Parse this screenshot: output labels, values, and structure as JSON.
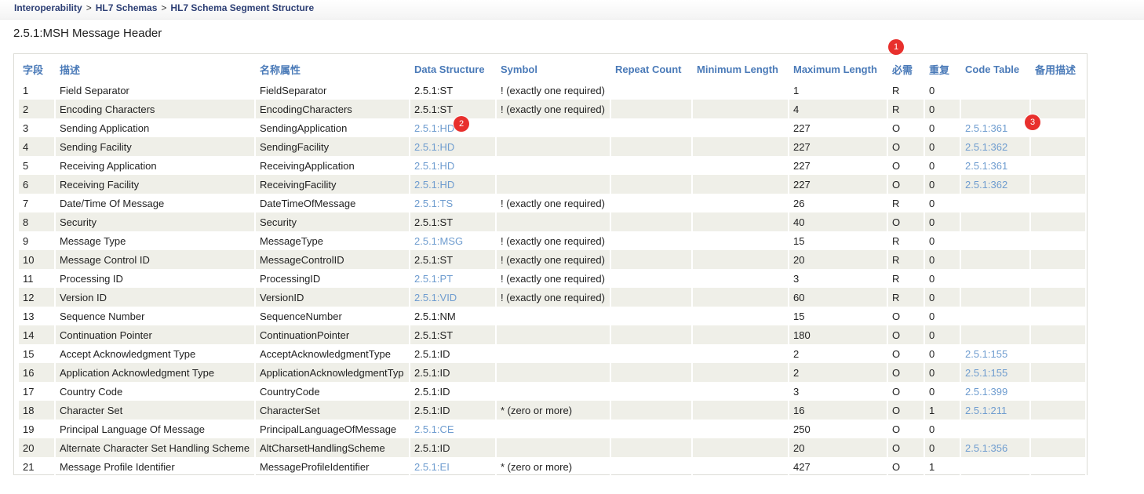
{
  "breadcrumb": {
    "items": [
      "Interoperability",
      "HL7 Schemas",
      "HL7 Schema Segment Structure"
    ],
    "separator": ">"
  },
  "page": {
    "title": "2.5.1:MSH Message Header"
  },
  "colors": {
    "header_text": "#4a7ab8",
    "link": "#6e9ccf",
    "row_alt": "#efefe8",
    "badge": "#e8302d"
  },
  "table": {
    "columns": [
      "字段",
      "描述",
      "名称属性",
      "Data Structure",
      "Symbol",
      "Repeat Count",
      "Minimum Length",
      "Maximum Length",
      "必需",
      "重复",
      "Code Table",
      "备用描述"
    ],
    "rows": [
      {
        "field": "1",
        "desc": "Field Separator",
        "name": "FieldSeparator",
        "ds": "2.5.1:ST",
        "ds_link": false,
        "symbol": "! (exactly one required)",
        "repeat": "",
        "min": "",
        "max": "1",
        "req": "R",
        "rep": "0",
        "code": "",
        "alt": ""
      },
      {
        "field": "2",
        "desc": "Encoding Characters",
        "name": "EncodingCharacters",
        "ds": "2.5.1:ST",
        "ds_link": false,
        "symbol": "! (exactly one required)",
        "repeat": "",
        "min": "",
        "max": "4",
        "req": "R",
        "rep": "0",
        "code": "",
        "alt": ""
      },
      {
        "field": "3",
        "desc": "Sending Application",
        "name": "SendingApplication",
        "ds": "2.5.1:HD",
        "ds_link": true,
        "symbol": "",
        "repeat": "",
        "min": "",
        "max": "227",
        "req": "O",
        "rep": "0",
        "code": "2.5.1:361",
        "alt": ""
      },
      {
        "field": "4",
        "desc": "Sending Facility",
        "name": "SendingFacility",
        "ds": "2.5.1:HD",
        "ds_link": true,
        "symbol": "",
        "repeat": "",
        "min": "",
        "max": "227",
        "req": "O",
        "rep": "0",
        "code": "2.5.1:362",
        "alt": ""
      },
      {
        "field": "5",
        "desc": "Receiving Application",
        "name": "ReceivingApplication",
        "ds": "2.5.1:HD",
        "ds_link": true,
        "symbol": "",
        "repeat": "",
        "min": "",
        "max": "227",
        "req": "O",
        "rep": "0",
        "code": "2.5.1:361",
        "alt": ""
      },
      {
        "field": "6",
        "desc": "Receiving Facility",
        "name": "ReceivingFacility",
        "ds": "2.5.1:HD",
        "ds_link": true,
        "symbol": "",
        "repeat": "",
        "min": "",
        "max": "227",
        "req": "O",
        "rep": "0",
        "code": "2.5.1:362",
        "alt": ""
      },
      {
        "field": "7",
        "desc": "Date/Time Of Message",
        "name": "DateTimeOfMessage",
        "ds": "2.5.1:TS",
        "ds_link": true,
        "symbol": "! (exactly one required)",
        "repeat": "",
        "min": "",
        "max": "26",
        "req": "R",
        "rep": "0",
        "code": "",
        "alt": ""
      },
      {
        "field": "8",
        "desc": "Security",
        "name": "Security",
        "ds": "2.5.1:ST",
        "ds_link": false,
        "symbol": "",
        "repeat": "",
        "min": "",
        "max": "40",
        "req": "O",
        "rep": "0",
        "code": "",
        "alt": ""
      },
      {
        "field": "9",
        "desc": "Message Type",
        "name": "MessageType",
        "ds": "2.5.1:MSG",
        "ds_link": true,
        "symbol": "! (exactly one required)",
        "repeat": "",
        "min": "",
        "max": "15",
        "req": "R",
        "rep": "0",
        "code": "",
        "alt": ""
      },
      {
        "field": "10",
        "desc": "Message Control ID",
        "name": "MessageControlID",
        "ds": "2.5.1:ST",
        "ds_link": false,
        "symbol": "! (exactly one required)",
        "repeat": "",
        "min": "",
        "max": "20",
        "req": "R",
        "rep": "0",
        "code": "",
        "alt": ""
      },
      {
        "field": "11",
        "desc": "Processing ID",
        "name": "ProcessingID",
        "ds": "2.5.1:PT",
        "ds_link": true,
        "symbol": "! (exactly one required)",
        "repeat": "",
        "min": "",
        "max": "3",
        "req": "R",
        "rep": "0",
        "code": "",
        "alt": ""
      },
      {
        "field": "12",
        "desc": "Version ID",
        "name": "VersionID",
        "ds": "2.5.1:VID",
        "ds_link": true,
        "symbol": "! (exactly one required)",
        "repeat": "",
        "min": "",
        "max": "60",
        "req": "R",
        "rep": "0",
        "code": "",
        "alt": ""
      },
      {
        "field": "13",
        "desc": "Sequence Number",
        "name": "SequenceNumber",
        "ds": "2.5.1:NM",
        "ds_link": false,
        "symbol": "",
        "repeat": "",
        "min": "",
        "max": "15",
        "req": "O",
        "rep": "0",
        "code": "",
        "alt": ""
      },
      {
        "field": "14",
        "desc": "Continuation Pointer",
        "name": "ContinuationPointer",
        "ds": "2.5.1:ST",
        "ds_link": false,
        "symbol": "",
        "repeat": "",
        "min": "",
        "max": "180",
        "req": "O",
        "rep": "0",
        "code": "",
        "alt": ""
      },
      {
        "field": "15",
        "desc": "Accept Acknowledgment Type",
        "name": "AcceptAcknowledgmentType",
        "ds": "2.5.1:ID",
        "ds_link": false,
        "symbol": "",
        "repeat": "",
        "min": "",
        "max": "2",
        "req": "O",
        "rep": "0",
        "code": "2.5.1:155",
        "alt": ""
      },
      {
        "field": "16",
        "desc": "Application Acknowledgment Type",
        "name": "ApplicationAcknowledgmentTyp",
        "ds": "2.5.1:ID",
        "ds_link": false,
        "symbol": "",
        "repeat": "",
        "min": "",
        "max": "2",
        "req": "O",
        "rep": "0",
        "code": "2.5.1:155",
        "alt": ""
      },
      {
        "field": "17",
        "desc": "Country Code",
        "name": "CountryCode",
        "ds": "2.5.1:ID",
        "ds_link": false,
        "symbol": "",
        "repeat": "",
        "min": "",
        "max": "3",
        "req": "O",
        "rep": "0",
        "code": "2.5.1:399",
        "alt": ""
      },
      {
        "field": "18",
        "desc": "Character Set",
        "name": "CharacterSet",
        "ds": "2.5.1:ID",
        "ds_link": false,
        "symbol": "* (zero or more)",
        "repeat": "",
        "min": "",
        "max": "16",
        "req": "O",
        "rep": "1",
        "code": "2.5.1:211",
        "alt": ""
      },
      {
        "field": "19",
        "desc": "Principal Language Of Message",
        "name": "PrincipalLanguageOfMessage",
        "ds": "2.5.1:CE",
        "ds_link": true,
        "symbol": "",
        "repeat": "",
        "min": "",
        "max": "250",
        "req": "O",
        "rep": "0",
        "code": "",
        "alt": ""
      },
      {
        "field": "20",
        "desc": "Alternate Character Set Handling Scheme",
        "name": "AltCharsetHandlingScheme",
        "ds": "2.5.1:ID",
        "ds_link": false,
        "symbol": "",
        "repeat": "",
        "min": "",
        "max": "20",
        "req": "O",
        "rep": "0",
        "code": "2.5.1:356",
        "alt": ""
      },
      {
        "field": "21",
        "desc": "Message Profile Identifier",
        "name": "MessageProfileIdentifier",
        "ds": "2.5.1:EI",
        "ds_link": true,
        "symbol": "* (zero or more)",
        "repeat": "",
        "min": "",
        "max": "427",
        "req": "O",
        "rep": "1",
        "code": "",
        "alt": ""
      }
    ]
  },
  "badges": [
    "1",
    "2",
    "3"
  ]
}
